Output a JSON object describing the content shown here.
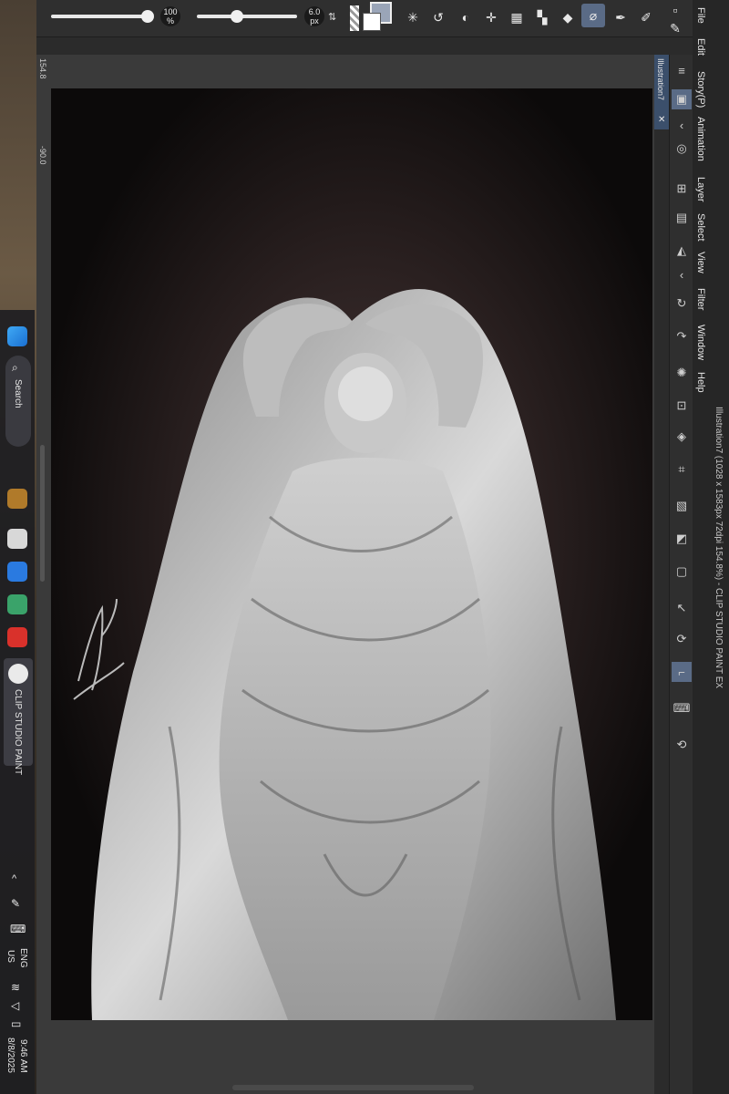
{
  "app": {
    "title": "Illustration7 (1028 x 1583px 72dpi 154.8%) - CLIP STUDIO PAINT EX",
    "tab_label": "Illustration7"
  },
  "menu": [
    "File",
    "Edit",
    "Story(P)",
    "Animation",
    "Layer",
    "Select",
    "View",
    "Filter",
    "Window",
    "Help"
  ],
  "toolbar": {
    "opacity_label": "100 %",
    "size_label": "6.0 px",
    "opacity_value": 1.0,
    "size_value": 0.35
  },
  "ruler": {
    "zoom": "154.8",
    "angle": "-90.0"
  },
  "taskbar": {
    "search_label": "Search",
    "active_app_label": "CLIP STUDIO PAINT",
    "language": "ENG",
    "region": "US",
    "time": "9:46 AM",
    "date": "8/8/2025"
  },
  "colors": {
    "panel": "#2f2f2f",
    "menu_bg": "#262626",
    "accent": "#3b4f6b",
    "canvas_glow": "#4a3a3a"
  }
}
